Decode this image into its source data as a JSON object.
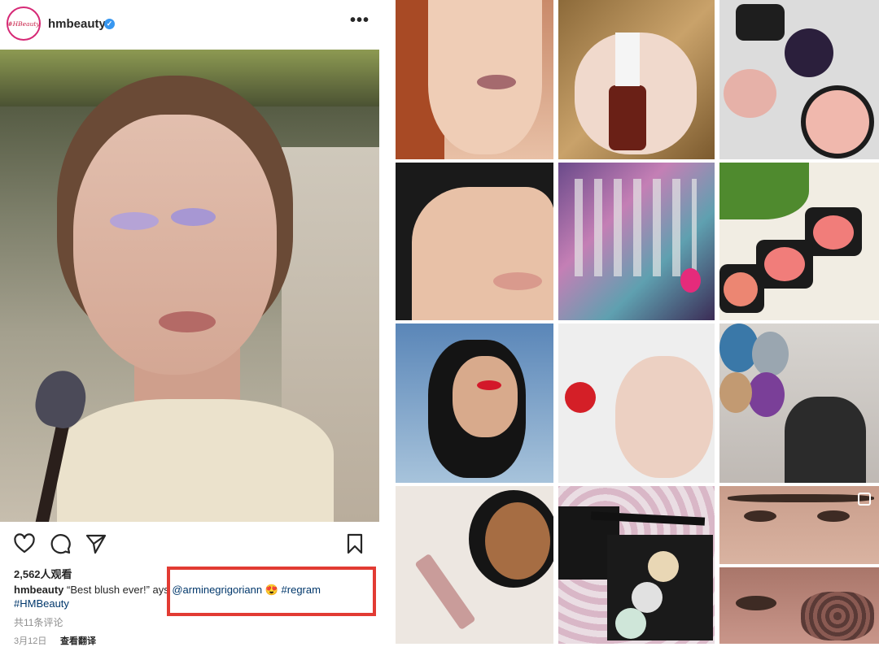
{
  "post": {
    "avatar_text": "#HBeauty",
    "username": "hmbeauty",
    "verified_glyph": "✓",
    "more_glyph": "•••",
    "views": "2,562人观看",
    "caption": {
      "user": "hmbeauty",
      "text_before": " “Best blush ever!” ",
      "text_obscured": "ays ",
      "mention": "@arminegrigoriann",
      "emoji": " 😍 ",
      "hashtag1": "#regram",
      "hashtag2": "#HMBeauty"
    },
    "comments": "共11条评论",
    "date": "3月12日",
    "translate": "查看翻译"
  },
  "icons": {
    "like": "heart-icon",
    "comment": "comment-icon",
    "share": "send-icon",
    "save": "bookmark-icon",
    "shop": "shopping-bag-icon",
    "multi": "multiple-images-icon",
    "verified": "verified-badge-icon"
  },
  "colors": {
    "highlight_box": "#e23b33",
    "link": "#00376b",
    "verified": "#3897f0",
    "avatar_ring": "#d62976"
  },
  "grid": {
    "tiles": [
      {
        "name": "redhead-portrait"
      },
      {
        "name": "red-nail-polish"
      },
      {
        "name": "blush-compacts"
      },
      {
        "name": "winged-eyeliner-portrait"
      },
      {
        "name": "makeup-brush-kit"
      },
      {
        "name": "pink-blush-palettes"
      },
      {
        "name": "red-lips-portrait"
      },
      {
        "name": "nail-art-hand"
      },
      {
        "name": "balloons-room"
      },
      {
        "name": "bronzer-compact"
      },
      {
        "name": "eyeshadow-palette"
      },
      {
        "name": "eye-makeup-closeup"
      },
      {
        "name": "glitter-nails-closeup"
      }
    ]
  }
}
